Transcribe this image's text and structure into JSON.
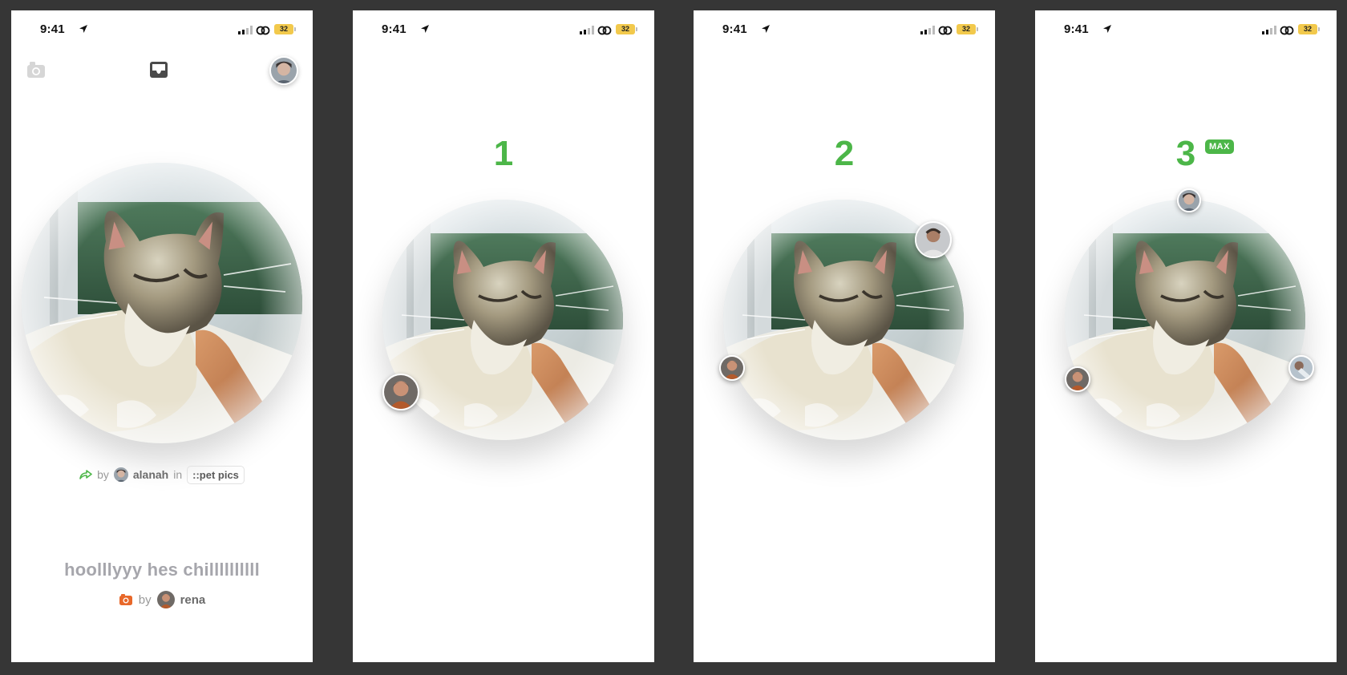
{
  "status_bar": {
    "time": "9:41",
    "battery": "32"
  },
  "screen1": {
    "attribution": {
      "by": "by",
      "user": "alanah",
      "in": "in",
      "channel": "::pet pics"
    },
    "caption": "hoolllyyy hes chillllllllll",
    "author": {
      "by": "by",
      "user": "rena"
    }
  },
  "screen2": {
    "count": "1"
  },
  "screen3": {
    "count": "2"
  },
  "screen4": {
    "count": "3",
    "badge": "MAX"
  },
  "colors": {
    "accent_green": "#4cb648",
    "camera_orange": "#e8682a",
    "battery_yellow": "#f2c94c"
  },
  "icons": [
    "location-arrow-icon",
    "signal-icon",
    "wifi-icon",
    "battery-icon",
    "camera-icon",
    "inbox-icon",
    "repost-icon"
  ]
}
